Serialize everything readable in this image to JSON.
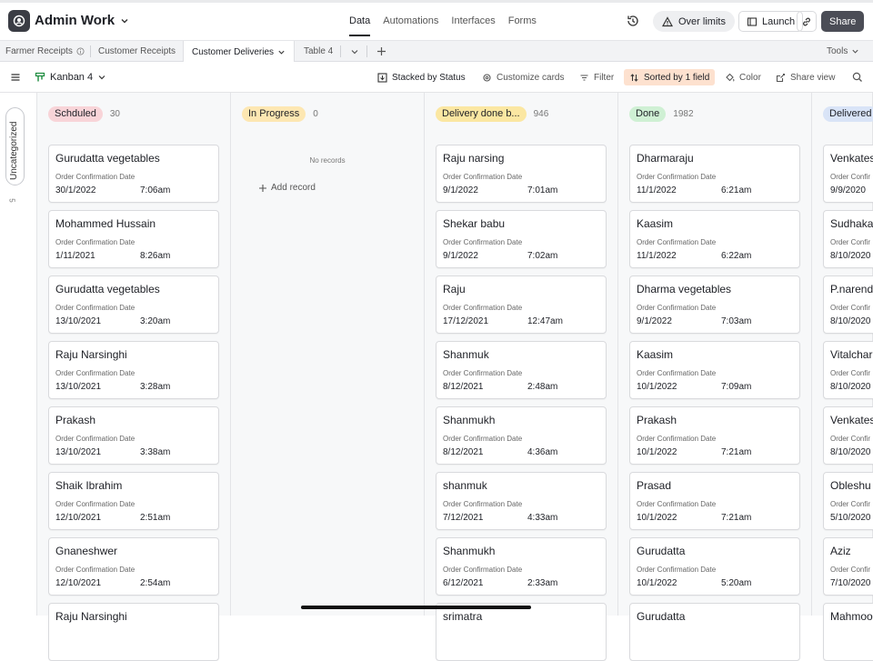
{
  "header": {
    "base_name": "Admin Work",
    "nav_tabs": [
      "Data",
      "Automations",
      "Interfaces",
      "Forms"
    ],
    "over_limits": "Over limits",
    "launch": "Launch",
    "share": "Share"
  },
  "tables": {
    "tabs": [
      "Farmer Receipts",
      "Customer Receipts",
      "Customer Deliveries",
      "Table 4"
    ],
    "tools": "Tools"
  },
  "viewbar": {
    "view_name": "Kanban 4",
    "stacked": "Stacked by Status",
    "customize": "Customize cards",
    "filter": "Filter",
    "sorted": "Sorted by 1 field",
    "color": "Color",
    "share_view": "Share view"
  },
  "uncategorized": {
    "label": "Uncategorized",
    "count": "5"
  },
  "columns": [
    {
      "label": "Schduled",
      "count": "30",
      "color": "#f8d4d8",
      "cards": [
        {
          "name": "Gurudatta vegetables",
          "field": "Order Confirmation Date",
          "date": "30/1/2022",
          "time": "7:06am"
        },
        {
          "name": "Mohammed Hussain",
          "field": "Order Confirmation Date",
          "date": "1/11/2021",
          "time": "8:26am"
        },
        {
          "name": "Gurudatta vegetables",
          "field": "Order Confirmation Date",
          "date": "13/10/2021",
          "time": "3:20am"
        },
        {
          "name": "Raju Narsinghi",
          "field": "Order Confirmation Date",
          "date": "13/10/2021",
          "time": "3:28am"
        },
        {
          "name": "Prakash",
          "field": "Order Confirmation Date",
          "date": "13/10/2021",
          "time": "3:38am"
        },
        {
          "name": "Shaik Ibrahim",
          "field": "Order Confirmation Date",
          "date": "12/10/2021",
          "time": "2:51am"
        },
        {
          "name": "Gnaneshwer",
          "field": "Order Confirmation Date",
          "date": "12/10/2021",
          "time": "2:54am"
        },
        {
          "name": "Raju Narsinghi",
          "field": "",
          "date": "",
          "time": ""
        }
      ]
    },
    {
      "label": "In Progress",
      "count": "0",
      "color": "#fde7b2",
      "no_records": "No records",
      "add_record": "Add record",
      "cards": []
    },
    {
      "label": "Delivery done b...",
      "count": "946",
      "color": "#fbe7a2",
      "cards": [
        {
          "name": "Raju narsing",
          "field": "Order Confirmation Date",
          "date": "9/1/2022",
          "time": "7:01am"
        },
        {
          "name": "Shekar babu",
          "field": "Order Confirmation Date",
          "date": "9/1/2022",
          "time": "7:02am"
        },
        {
          "name": "Raju",
          "field": "Order Confirmation Date",
          "date": "17/12/2021",
          "time": "12:47am"
        },
        {
          "name": "Shanmuk",
          "field": "Order Confirmation Date",
          "date": "8/12/2021",
          "time": "2:48am"
        },
        {
          "name": "Shanmukh",
          "field": "Order Confirmation Date",
          "date": "8/12/2021",
          "time": "4:36am"
        },
        {
          "name": "shanmuk",
          "field": "Order Confirmation Date",
          "date": "7/12/2021",
          "time": "4:33am"
        },
        {
          "name": "Shanmukh",
          "field": "Order Confirmation Date",
          "date": "6/12/2021",
          "time": "2:33am"
        },
        {
          "name": "srimatra",
          "field": "",
          "date": "",
          "time": ""
        }
      ]
    },
    {
      "label": "Done",
      "count": "1982",
      "color": "#cff0d4",
      "cards": [
        {
          "name": "Dharmaraju",
          "field": "Order Confirmation Date",
          "date": "11/1/2022",
          "time": "6:21am"
        },
        {
          "name": "Kaasim",
          "field": "Order Confirmation Date",
          "date": "11/1/2022",
          "time": "6:22am"
        },
        {
          "name": "Dharma vegetables",
          "field": "Order Confirmation Date",
          "date": "9/1/2022",
          "time": "7:03am"
        },
        {
          "name": "Kaasim",
          "field": "Order Confirmation Date",
          "date": "10/1/2022",
          "time": "7:09am"
        },
        {
          "name": "Prakash",
          "field": "Order Confirmation Date",
          "date": "10/1/2022",
          "time": "7:21am"
        },
        {
          "name": "Prasad",
          "field": "Order Confirmation Date",
          "date": "10/1/2022",
          "time": "7:21am"
        },
        {
          "name": "Gurudatta",
          "field": "Order Confirmation Date",
          "date": "10/1/2022",
          "time": "5:20am"
        },
        {
          "name": "Gurudatta",
          "field": "",
          "date": "",
          "time": ""
        }
      ]
    },
    {
      "label": "Delivered",
      "count": "",
      "color": "#d9e4f7",
      "cards": [
        {
          "name": "Venkates",
          "field": "Order Confir",
          "date": "9/9/2020",
          "time": ""
        },
        {
          "name": "Sudhaka",
          "field": "Order Confir",
          "date": "8/10/2020",
          "time": ""
        },
        {
          "name": "P.narend",
          "field": "Order Confir",
          "date": "8/10/2020",
          "time": ""
        },
        {
          "name": "Vitalchar",
          "field": "Order Confir",
          "date": "8/10/2020",
          "time": ""
        },
        {
          "name": "Venkates",
          "field": "Order Confir",
          "date": "8/10/2020",
          "time": ""
        },
        {
          "name": "Obleshu",
          "field": "Order Confir",
          "date": "5/10/2020",
          "time": ""
        },
        {
          "name": "Aziz",
          "field": "Order Confir",
          "date": "7/10/2020",
          "time": ""
        },
        {
          "name": "Mahmoo",
          "field": "",
          "date": "",
          "time": ""
        }
      ]
    }
  ]
}
